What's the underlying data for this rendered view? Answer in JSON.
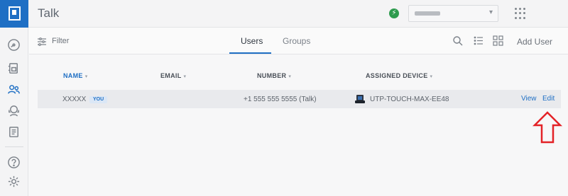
{
  "app": {
    "title": "Talk"
  },
  "header": {
    "console_select_icon": "chevron-down-icon",
    "apps_icon": "grid-icon",
    "status_icon": "lightning-icon"
  },
  "sidebar": {
    "items": [
      {
        "icon": "dashboard-icon"
      },
      {
        "icon": "phonebook-icon"
      },
      {
        "icon": "users-icon",
        "active": true
      },
      {
        "icon": "support-icon"
      },
      {
        "icon": "call-log-icon"
      },
      {
        "icon": "help-icon"
      },
      {
        "icon": "settings-icon"
      }
    ]
  },
  "toolbar": {
    "filter_label": "Filter",
    "tabs": [
      {
        "label": "Users",
        "active": true
      },
      {
        "label": "Groups"
      }
    ],
    "add_user_label": "Add User"
  },
  "table": {
    "columns": [
      {
        "label": "NAME",
        "sorted": true
      },
      {
        "label": "EMAIL"
      },
      {
        "label": "NUMBER"
      },
      {
        "label": "ASSIGNED DEVICE"
      }
    ],
    "rows": [
      {
        "name": "XXXXX",
        "badge": "YOU",
        "email": "",
        "number": "+1 555 555 5555 (Talk)",
        "device": "UTP-TOUCH-MAX-EE48",
        "view_label": "View",
        "edit_label": "Edit"
      }
    ]
  },
  "annotation": {
    "type": "up-arrow",
    "color": "#e32227"
  },
  "colors": {
    "accent": "#1f6fc4",
    "status": "#2e9b4e",
    "annotation": "#e32227"
  }
}
